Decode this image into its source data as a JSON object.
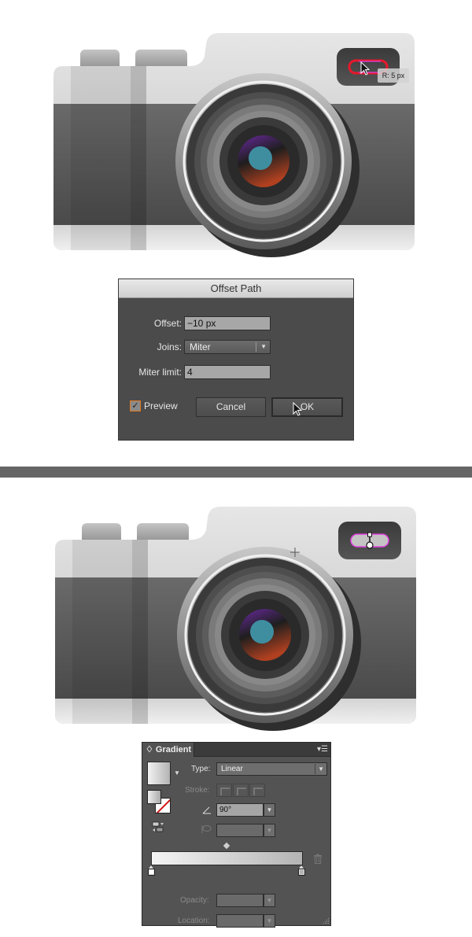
{
  "tooltip": {
    "text": "R: 5 px"
  },
  "offset_path_dialog": {
    "title": "Offset Path",
    "offset": {
      "label": "Offset:",
      "value": "−10 px"
    },
    "joins": {
      "label": "Joins:",
      "value": "Miter"
    },
    "miter_limit": {
      "label": "Miter limit:",
      "value": "4"
    },
    "preview": {
      "label": "Preview",
      "checked": true
    },
    "cancel_label": "Cancel",
    "ok_label": "OK"
  },
  "gradient_panel": {
    "tab_label": "♢ Gradient",
    "type": {
      "label": "Type:",
      "value": "Linear"
    },
    "stroke": {
      "label": "Stroke:"
    },
    "angle": {
      "value": "90°"
    },
    "aspect_ratio": {
      "value": ""
    },
    "gradient_stops": [
      {
        "color": "#ffffff"
      },
      {
        "color": "#b3b3b3"
      }
    ],
    "opacity": {
      "label": "Opacity:",
      "value": ""
    },
    "location": {
      "label": "Location:",
      "value": ""
    }
  },
  "colors": {
    "dialog_bg": "#4b4b4b",
    "panel_bg": "#535353",
    "divider": "#666666",
    "selection_magenta": "#e040e0",
    "path_red": "#e8182c",
    "checkbox_accent": "#e07a22"
  }
}
